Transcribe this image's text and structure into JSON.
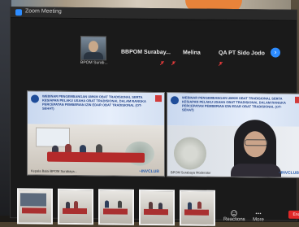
{
  "window": {
    "title": "Zoom Meeting"
  },
  "participants_strip": [
    {
      "name": "BPOM Surab...",
      "type": "video"
    },
    {
      "name": "BBPOM Surabay...",
      "type": "name"
    },
    {
      "name": "Melina",
      "type": "name"
    },
    {
      "name": "QA PT Sido Jodo",
      "type": "name"
    }
  ],
  "more_button": {
    "label": "›"
  },
  "panels": [
    {
      "banner_text": "WEBINAR PENGEMBANGAN UMKM OBAT TRADISIONAL SERTA KESIAPAN PELAKU USAHA OBAT TRADISIONAL DALAM RANGKA PERCEPATAN PEMBERIAN IZIN EDAR OBAT TRADISIONAL (OT-SEHAT)",
      "caption": "Kepala Balai BPOM Surabaya...",
      "sponsor": "~INVCLUB"
    },
    {
      "banner_text": "WEBINAR PENGEMBANGAN UMKM OBAT TRADISIONAL SERTA KESIAPAN PELAKU USAHA OBAT TRADISIONAL DALAM RANGKA PERCEPATAN PEMBERIAN IZIN EDAR OBAT TRADISIONAL (OT-SEHAT)",
      "caption": "BPOM Surabaya Moderator",
      "sponsor": "~INVCLUB"
    }
  ],
  "thumbnails": [
    {
      "label": "thumb-1"
    },
    {
      "label": "thumb-2"
    },
    {
      "label": "thumb-3"
    },
    {
      "label": "thumb-4"
    },
    {
      "label": "thumb-5"
    }
  ],
  "controls": {
    "reactions": "Reactions",
    "more": "More",
    "end": "End"
  },
  "colors": {
    "accent": "#2d8cff",
    "end": "#e02828",
    "muted": "#e03a3a"
  }
}
